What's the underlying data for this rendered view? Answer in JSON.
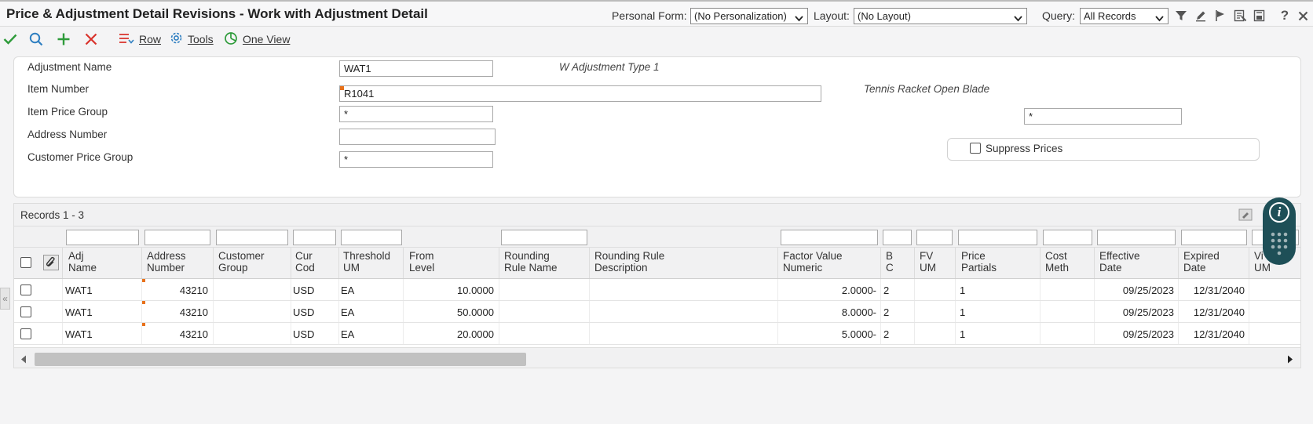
{
  "header": {
    "title": "Price & Adjustment Detail Revisions - Work with Adjustment Detail",
    "personal_form_label": "Personal Form:",
    "personal_form_value": "(No Personalization)",
    "layout_label": "Layout:",
    "layout_value": "(No Layout)",
    "query_label": "Query:",
    "query_value": "All Records",
    "icons": [
      "filter-icon",
      "edit-pencil-icon",
      "flag-icon",
      "report-icon",
      "export-icon",
      "help-icon",
      "close-icon"
    ]
  },
  "toolbar": {
    "row_label": "Row",
    "tools_label": "Tools",
    "one_view_label": "One View",
    "icons": [
      "check-icon",
      "search-icon",
      "add-icon",
      "delete-icon"
    ]
  },
  "form": {
    "adjustment_name_label": "Adjustment Name",
    "adjustment_name_value": "WAT1",
    "adjustment_name_desc": "W Adjustment Type 1",
    "item_number_label": "Item Number",
    "item_number_value": "R1041",
    "item_number_desc": "Tennis Racket Open Blade",
    "item_price_group_label": "Item Price Group",
    "item_price_group_value": "*",
    "right_field_value": "*",
    "address_number_label": "Address Number",
    "address_number_value": "",
    "customer_price_group_label": "Customer Price Group",
    "customer_price_group_value": "*",
    "suppress_prices_label": "Suppress Prices",
    "suppress_prices_checked": false
  },
  "grid": {
    "records_label": "Records 1 - 3",
    "columns": [
      "Adj\nName",
      "Address\nNumber",
      "Customer\nGroup",
      "Cur\nCod",
      "Threshold\nUM",
      "From\nLevel",
      "Rounding\nRule Name",
      "Rounding Rule\nDescription",
      "Factor Value\nNumeric",
      "B\nC",
      "FV\nUM",
      "Price\nPartials",
      "Cost\nMeth",
      "Effective\nDate",
      "Expired\nDate",
      "Vi\nUM"
    ],
    "rows": [
      {
        "adj_name": "WAT1",
        "address_number": "43210",
        "customer_group": "",
        "cur_cod": "USD",
        "threshold_um": "EA",
        "from_level": "10.0000",
        "rounding_rule_name": "",
        "rounding_rule_desc": "",
        "factor_value": "2.0000-",
        "bc": "2",
        "fv_um": "",
        "price_partials": "1",
        "cost_meth": "",
        "effective_date": "09/25/2023",
        "expired_date": "12/31/2040"
      },
      {
        "adj_name": "WAT1",
        "address_number": "43210",
        "customer_group": "",
        "cur_cod": "USD",
        "threshold_um": "EA",
        "from_level": "50.0000",
        "rounding_rule_name": "",
        "rounding_rule_desc": "",
        "factor_value": "8.0000-",
        "bc": "2",
        "fv_um": "",
        "price_partials": "1",
        "cost_meth": "",
        "effective_date": "09/25/2023",
        "expired_date": "12/31/2040"
      },
      {
        "adj_name": "WAT1",
        "address_number": "43210",
        "customer_group": "",
        "cur_cod": "USD",
        "threshold_um": "EA",
        "from_level": "20.0000",
        "rounding_rule_name": "",
        "rounding_rule_desc": "",
        "factor_value": "5.0000-",
        "bc": "2",
        "fv_um": "",
        "price_partials": "1",
        "cost_meth": "",
        "effective_date": "09/25/2023",
        "expired_date": "12/31/2040"
      }
    ]
  },
  "colors": {
    "check_green": "#2e9b3a",
    "add_green": "#2e9b3a",
    "delete_red": "#d9322b",
    "accent_blue": "#2f7fc1",
    "required_orange": "#e8711a",
    "info_widget_teal": "#1e4f57"
  }
}
